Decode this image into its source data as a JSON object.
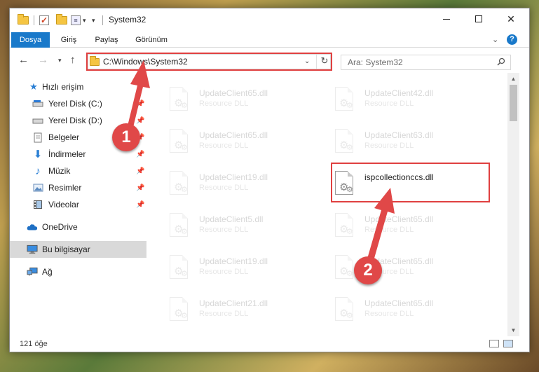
{
  "window": {
    "title": "System32"
  },
  "ribbon": {
    "tabs": [
      {
        "label": "Dosya"
      },
      {
        "label": "Giriş"
      },
      {
        "label": "Paylaş"
      },
      {
        "label": "Görünüm"
      }
    ],
    "help": "?"
  },
  "address": {
    "path": "C:\\Windows\\System32",
    "search_placeholder": "Ara: System32"
  },
  "sidebar": {
    "items": [
      {
        "label": "Hızlı erişim",
        "icon": "star-icon"
      },
      {
        "label": "Yerel Disk (C:)",
        "icon": "drive-icon"
      },
      {
        "label": "Yerel Disk (D:)",
        "icon": "drive-icon"
      },
      {
        "label": "Belgeler",
        "icon": "documents-icon"
      },
      {
        "label": "İndirmeler",
        "icon": "download-icon"
      },
      {
        "label": "Müzik",
        "icon": "music-icon"
      },
      {
        "label": "Resimler",
        "icon": "pictures-icon"
      },
      {
        "label": "Videolar",
        "icon": "video-icon"
      },
      {
        "label": "OneDrive",
        "icon": "cloud-icon"
      },
      {
        "label": "Bu bilgisayar",
        "icon": "computer-icon"
      },
      {
        "label": "Ağ",
        "icon": "network-icon"
      }
    ]
  },
  "files": [
    {
      "name": "UpdateClient65.dll",
      "type": "Resource DLL"
    },
    {
      "name": "UpdateClient42.dll",
      "type": "Resource DLL"
    },
    {
      "name": "UpdateClient65.dll",
      "type": "Resource DLL"
    },
    {
      "name": "UpdateClient63.dll",
      "type": "Resource DLL"
    },
    {
      "name": "UpdateClient19.dll",
      "type": "Resource DLL"
    },
    {
      "name": "ispcollectionccs.dll",
      "type": ""
    },
    {
      "name": "UpdateClient5.dll",
      "type": "Resource DLL"
    },
    {
      "name": "UpdateClient65.dll",
      "type": "Resource DLL"
    },
    {
      "name": "UpdateClient19.dll",
      "type": "Resource DLL"
    },
    {
      "name": "UpdateClient65.dll",
      "type": "Resource DLL"
    },
    {
      "name": "UpdateClient21.dll",
      "type": "Resource DLL"
    },
    {
      "name": "UpdateClient65.dll",
      "type": "Resource DLL"
    }
  ],
  "status": {
    "count": "121 öğe"
  },
  "annotations": {
    "step1": "1",
    "step2": "2",
    "color": "#e04848"
  }
}
